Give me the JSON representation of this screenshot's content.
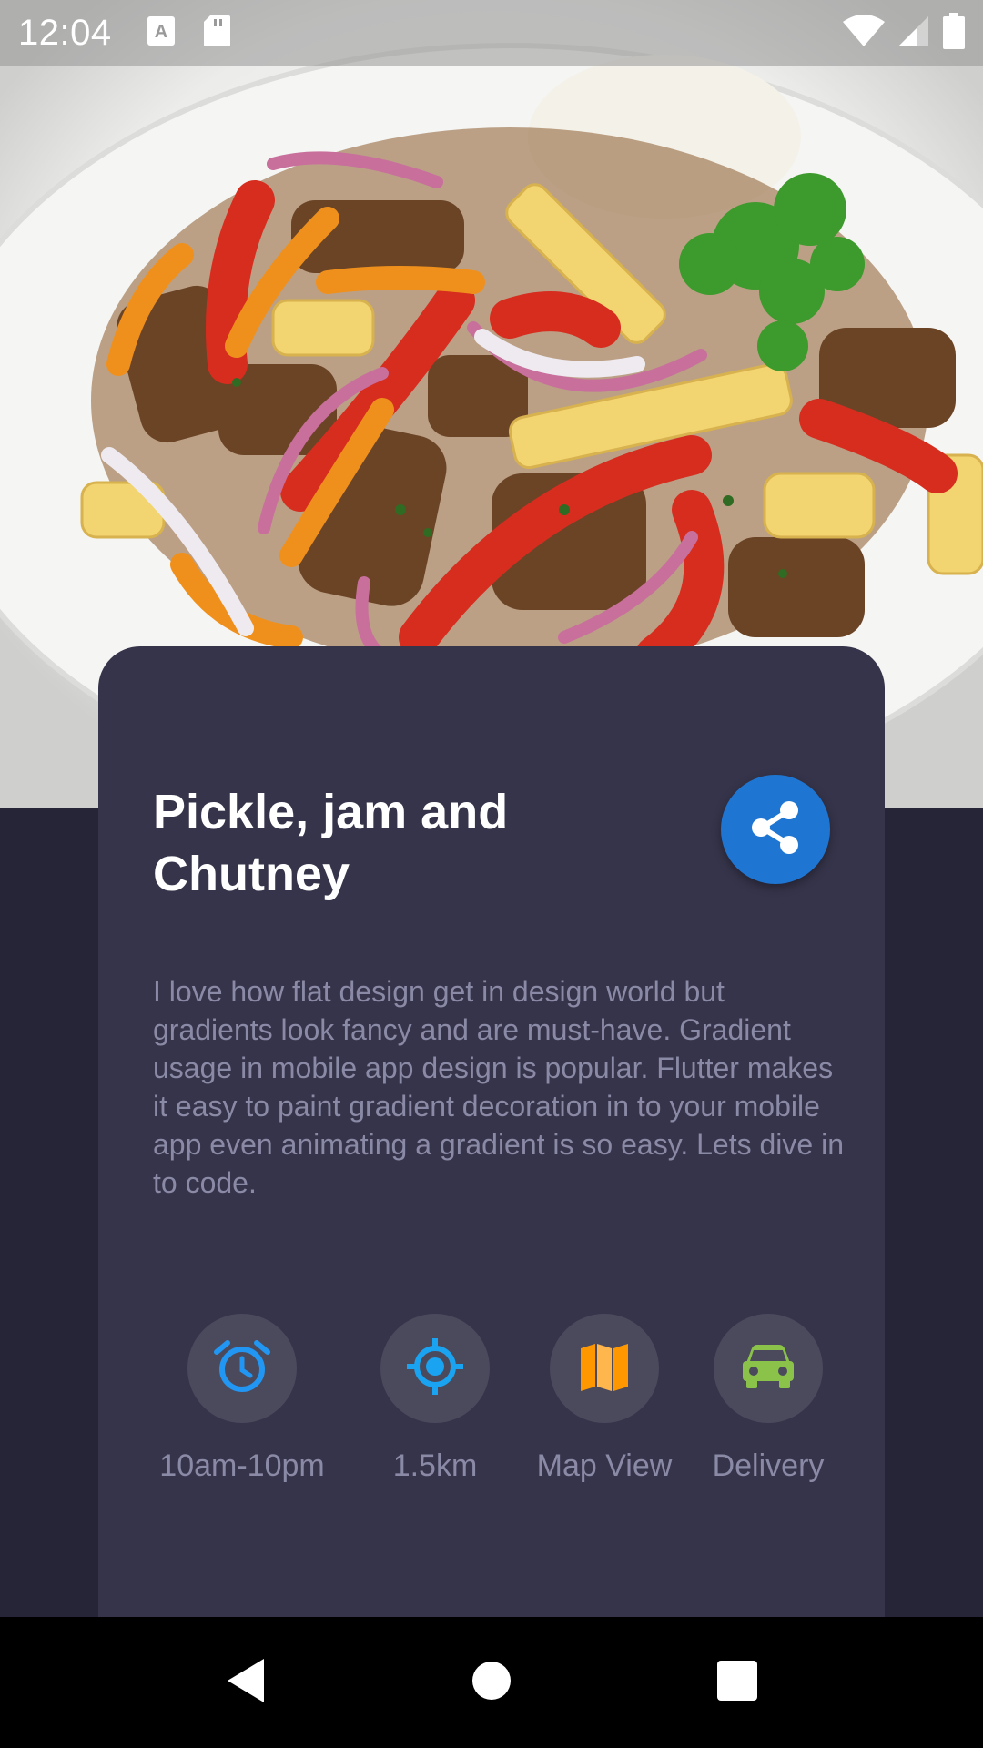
{
  "status_bar": {
    "time": "12:04",
    "left_icons": [
      "a-keyboard-icon",
      "sd-card-icon"
    ],
    "right_icons": [
      "wifi-icon",
      "cell-signal-icon",
      "battery-icon"
    ]
  },
  "hero": {
    "image": "food-photo"
  },
  "card": {
    "title": "Pickle, jam and Chutney",
    "share_icon": "share-icon",
    "share_color": "#1e76d2",
    "description": "I love how flat design get in design world but gradients look fancy and are must-have. Gradient usage in mobile app design is popular. Flutter makes it easy to paint gradient decoration in to your mobile app even animating a gradient is so easy. Lets dive in to code.",
    "features": [
      {
        "icon": "alarm-icon",
        "label": "10am-10pm",
        "color": "#2196f3"
      },
      {
        "icon": "gps-target-icon",
        "label": "1.5km",
        "color": "#1aa3f0"
      },
      {
        "icon": "map-icon",
        "label": "Map View",
        "color": "#ff9800"
      },
      {
        "icon": "car-icon",
        "label": "Delivery",
        "color": "#8bc34a"
      }
    ]
  },
  "nav_bar": {
    "buttons": [
      "back-icon",
      "home-icon",
      "recents-icon"
    ]
  },
  "colors": {
    "background": "#262437",
    "card": "#36344a",
    "icon_circle": "#4b4a5c",
    "muted_text": "#8b8aa6"
  }
}
